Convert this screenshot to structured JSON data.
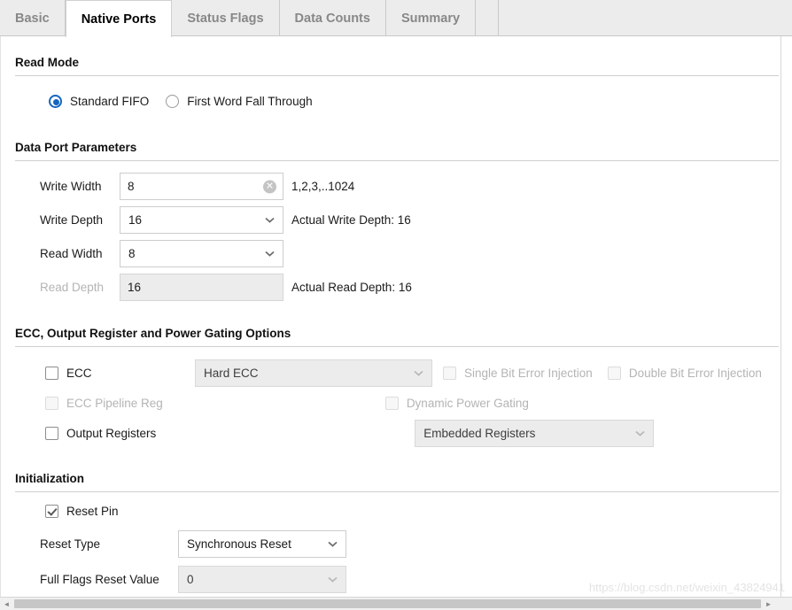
{
  "tabs": [
    {
      "label": "Basic",
      "active": false
    },
    {
      "label": "Native Ports",
      "active": true
    },
    {
      "label": "Status Flags",
      "active": false
    },
    {
      "label": "Data Counts",
      "active": false
    },
    {
      "label": "Summary",
      "active": false
    }
  ],
  "read_mode": {
    "title": "Read Mode",
    "options": [
      {
        "label": "Standard FIFO",
        "selected": true
      },
      {
        "label": "First Word Fall Through",
        "selected": false
      }
    ]
  },
  "data_port": {
    "title": "Data Port Parameters",
    "write_width": {
      "label": "Write Width",
      "value": "8",
      "hint": "1,2,3,..1024",
      "clear_icon": "clear-circle-icon"
    },
    "write_depth": {
      "label": "Write Depth",
      "value": "16",
      "hint": "Actual Write Depth: 16"
    },
    "read_width": {
      "label": "Read Width",
      "value": "8"
    },
    "read_depth": {
      "label": "Read Depth",
      "value": "16",
      "hint": "Actual Read Depth: 16",
      "disabled": true
    }
  },
  "ecc": {
    "title": "ECC, Output Register and Power Gating Options",
    "ecc_checkbox": {
      "label": "ECC",
      "checked": false,
      "disabled": false
    },
    "ecc_type": {
      "value": "Hard ECC",
      "disabled": true
    },
    "single_bit": {
      "label": "Single Bit Error Injection",
      "checked": false,
      "disabled": true
    },
    "double_bit": {
      "label": "Double Bit Error Injection",
      "checked": false,
      "disabled": true
    },
    "pipeline_reg": {
      "label": "ECC Pipeline Reg",
      "checked": false,
      "disabled": true
    },
    "power_gating": {
      "label": "Dynamic Power Gating",
      "checked": false,
      "disabled": true
    },
    "output_registers": {
      "label": "Output Registers",
      "checked": false,
      "disabled": false
    },
    "register_type": {
      "value": "Embedded Registers",
      "disabled": true
    }
  },
  "initialization": {
    "title": "Initialization",
    "reset_pin": {
      "label": "Reset Pin",
      "checked": true
    },
    "reset_type": {
      "label": "Reset Type",
      "value": "Synchronous Reset"
    },
    "full_flags_reset": {
      "label": "Full Flags Reset Value",
      "value": "0"
    }
  },
  "watermark": "https://blog.csdn.net/weixin_43824941",
  "scrollbar": {
    "left_arrow": "◄",
    "right_arrow": "►"
  },
  "colors": {
    "accent": "#1565c0",
    "tab_bar_bg": "#ececec",
    "disabled_text": "#b4b4b4",
    "disabled_field_bg": "#ececec"
  }
}
